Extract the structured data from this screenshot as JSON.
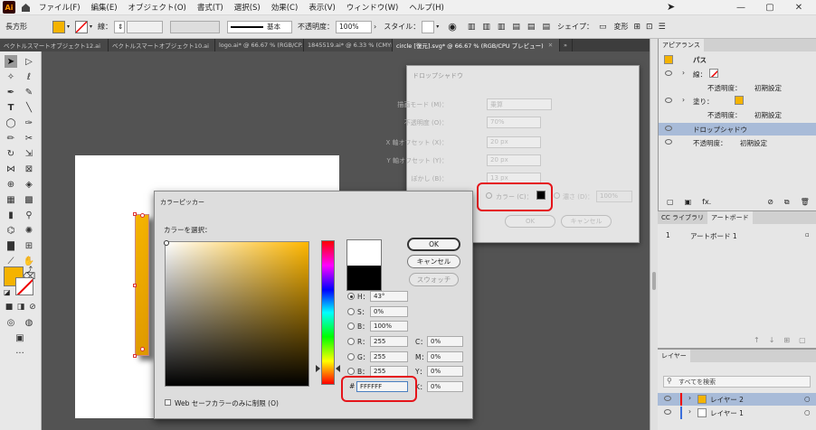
{
  "menubar": {
    "logo": "Ai",
    "items": [
      "ファイル(F)",
      "編集(E)",
      "オブジェクト(O)",
      "書式(T)",
      "選択(S)",
      "効果(C)",
      "表示(V)",
      "ウィンドウ(W)",
      "ヘルプ(H)"
    ]
  },
  "controlbar": {
    "tool_name": "長方形",
    "stroke_label": "線：",
    "stroke_style": "基本",
    "opacity_label": "不透明度：",
    "opacity_value": "100%",
    "style_label": "スタイル：",
    "shape_label": "シェイプ：",
    "transform_label": "変形",
    "colors": {
      "fill": "#f5b300"
    }
  },
  "tabs": [
    {
      "label": "ベクトルスマートオブジェクト12.ai",
      "active": false
    },
    {
      "label": "ベクトルスマートオブジェクト10.ai",
      "active": false
    },
    {
      "label": "logo.ai* @ 66.67 % (RGB/CP...",
      "active": false
    },
    {
      "label": "1845519.ai* @ 6.33 % (CMYK...",
      "active": false
    },
    {
      "label": "circle [復元].svg* @ 66.67 % (RGB/CPU プレビュー)",
      "active": true
    }
  ],
  "drop_shadow_dialog": {
    "title": "ドロップシャドウ",
    "blend_mode_label": "描画モード (M)：",
    "blend_mode_value": "乗算",
    "opacity_label": "不透明度 (O)：",
    "opacity_value": "70%",
    "x_offset_label": "X 軸オフセット (X)：",
    "x_offset_value": "20 px",
    "y_offset_label": "Y 軸オフセット (Y)：",
    "y_offset_value": "20 px",
    "blur_label": "ぼかし (B)：",
    "blur_value": "13 px",
    "color_label": "カラー (C)：",
    "darkness_label": "濃さ (D)：",
    "darkness_value": "100%",
    "ok": "OK",
    "cancel": "キャンセル"
  },
  "color_picker": {
    "title": "カラーピッカー",
    "select_label": "カラーを選択：",
    "ok": "OK",
    "cancel": "キャンセル",
    "swatches": "スウォッチ",
    "h_label": "H：",
    "h_value": "43°",
    "s_label": "S：",
    "s_value": "0%",
    "b_label": "B：",
    "b_value": "100%",
    "r_label": "R：",
    "r_value": "255",
    "g_label": "G：",
    "g_value": "255",
    "bb_label": "B：",
    "bb_value": "255",
    "c_label": "C：",
    "c_value": "0%",
    "m_label": "M：",
    "m_value": "0%",
    "y_label": "Y：",
    "y_value": "0%",
    "k_label": "K：",
    "k_value": "0%",
    "hex_label": "#",
    "hex_value": "FFFFFF",
    "web_safe_label": "Web セーフカラーのみに制限 (O)",
    "colors": {
      "new": "#ffffff",
      "old": "#000000"
    }
  },
  "appearance_panel": {
    "tab": "アピアランス",
    "path_label": "パス",
    "stroke_label": "線：",
    "opacity_label": "不透明度：",
    "opacity_value": "初期設定",
    "fill_label": "塗り：",
    "fill_opacity_value": "初期設定",
    "drop_shadow": "ドロップシャドウ",
    "total_opacity_label": "不透明度：",
    "total_opacity_value": "初期設定"
  },
  "artboard_panel": {
    "tab_library": "CC ライブラリ",
    "tab_artboard": "アートボード",
    "row_num": "1",
    "row_name": "アートボード 1"
  },
  "layers_panel": {
    "tab": "レイヤー",
    "search_placeholder": "すべてを検索",
    "layers": [
      "レイヤー 2",
      "レイヤー 1"
    ]
  }
}
